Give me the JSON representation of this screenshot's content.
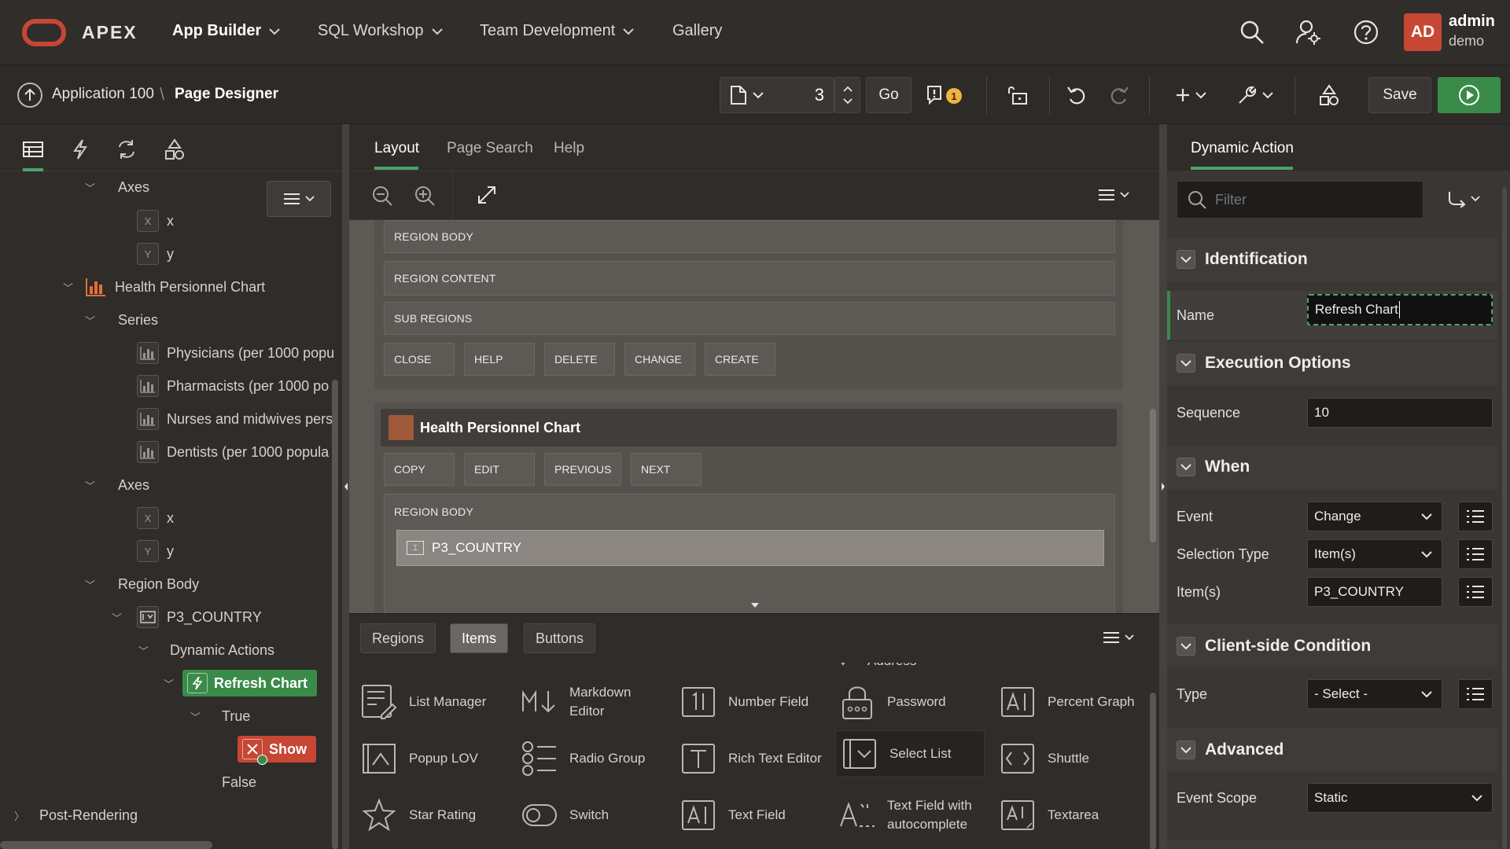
{
  "topnav": {
    "brand": "APEX",
    "items": [
      {
        "label": "App Builder"
      },
      {
        "label": "SQL Workshop"
      },
      {
        "label": "Team Development"
      },
      {
        "label": "Gallery"
      }
    ],
    "avatar_initials": "AD",
    "user_name": "admin",
    "workspace": "demo"
  },
  "toolbar": {
    "breadcrumb_app": "Application 100",
    "breadcrumb_sep": "\\",
    "breadcrumb_page": "Page Designer",
    "page_number": "3",
    "go_label": "Go",
    "message_count": "1",
    "save_label": "Save"
  },
  "left_tree": {
    "nodes": [
      {
        "label": "Axes"
      },
      {
        "label": "x",
        "icon_text": "X"
      },
      {
        "label": "y",
        "icon_text": "Y"
      },
      {
        "label": "Health Persionnel Chart"
      },
      {
        "label": "Series"
      },
      {
        "label": "Physicians (per 1000 popu"
      },
      {
        "label": "Pharmacists (per 1000 po"
      },
      {
        "label": "Nurses and midwives pers"
      },
      {
        "label": "Dentists (per 1000 popula"
      },
      {
        "label": "Axes"
      },
      {
        "label": "x",
        "icon_text": "X"
      },
      {
        "label": "y",
        "icon_text": "Y"
      },
      {
        "label": "Region Body"
      },
      {
        "label": "P3_COUNTRY"
      },
      {
        "label": "Dynamic Actions"
      },
      {
        "label": "Refresh Chart"
      },
      {
        "label": "True"
      },
      {
        "label": "Show"
      },
      {
        "label": "False"
      },
      {
        "label": "Post-Rendering"
      }
    ]
  },
  "middle": {
    "tabs": [
      {
        "label": "Layout"
      },
      {
        "label": "Page Search"
      },
      {
        "label": "Help"
      }
    ],
    "layout": {
      "region_body_1": "REGION BODY",
      "region_content": "REGION CONTENT",
      "sub_regions": "SUB REGIONS",
      "buttons_1": [
        "CLOSE",
        "HELP",
        "DELETE",
        "CHANGE",
        "CREATE"
      ],
      "region_title": "Health Persionnel Chart",
      "buttons_2": [
        "COPY",
        "EDIT",
        "PREVIOUS",
        "NEXT"
      ],
      "region_body_2": "REGION BODY",
      "item_name": "P3_COUNTRY"
    },
    "gallery": {
      "tabs": [
        {
          "label": "Regions"
        },
        {
          "label": "Items"
        },
        {
          "label": "Buttons"
        }
      ],
      "partial_items": [
        "Address"
      ],
      "rows": [
        [
          {
            "label": "List Manager"
          },
          {
            "label": "Markdown Editor"
          },
          {
            "label": "Number Field"
          },
          {
            "label": "Password"
          },
          {
            "label": "Percent Graph"
          }
        ],
        [
          {
            "label": "Popup LOV"
          },
          {
            "label": "Radio Group"
          },
          {
            "label": "Rich Text Editor"
          },
          {
            "label": "Select List"
          },
          {
            "label": "Shuttle"
          }
        ],
        [
          {
            "label": "Star Rating"
          },
          {
            "label": "Switch"
          },
          {
            "label": "Text Field"
          },
          {
            "label": "Text Field with autocomplete"
          },
          {
            "label": "Textarea"
          }
        ]
      ]
    }
  },
  "right": {
    "tab": "Dynamic Action",
    "filter_placeholder": "Filter",
    "sections": {
      "identification": "Identification",
      "execution": "Execution Options",
      "when": "When",
      "condition": "Client-side Condition",
      "advanced": "Advanced"
    },
    "props": {
      "name_label": "Name",
      "name_value": "Refresh Chart",
      "sequence_label": "Sequence",
      "sequence_value": "10",
      "event_label": "Event",
      "event_value": "Change",
      "seltype_label": "Selection Type",
      "seltype_value": "Item(s)",
      "items_label": "Item(s)",
      "items_value": "P3_COUNTRY",
      "type_label": "Type",
      "type_value": "- Select -",
      "scope_label": "Event Scope",
      "scope_value": "Static"
    }
  },
  "colors": {
    "accent_red": "#c74634",
    "success_green": "#3a8b4a",
    "tab_underline": "#4fa36a",
    "badge_yellow": "#f0b43c"
  }
}
